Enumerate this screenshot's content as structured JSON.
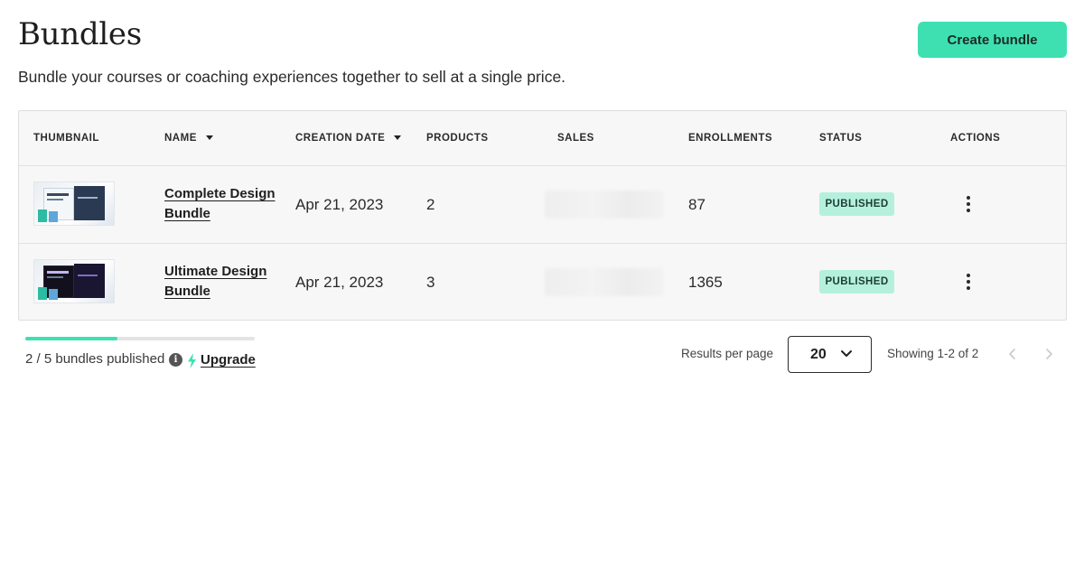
{
  "header": {
    "title": "Bundles",
    "subtitle": "Bundle your courses or coaching experiences together to sell at a single price.",
    "create_label": "Create bundle"
  },
  "table": {
    "columns": [
      "THUMBNAIL",
      "NAME",
      "CREATION DATE",
      "PRODUCTS",
      "SALES",
      "ENROLLMENTS",
      "STATUS",
      "ACTIONS"
    ],
    "rows": [
      {
        "name": "Complete Design Bundle",
        "date": "Apr 21, 2023",
        "products": "2",
        "enrollments": "87",
        "status": "PUBLISHED"
      },
      {
        "name": "Ultimate Design Bundle",
        "date": "Apr 21, 2023",
        "products": "3",
        "enrollments": "1365",
        "status": "PUBLISHED"
      }
    ]
  },
  "footer": {
    "published_text": "2 / 5 bundles published",
    "published_fraction": 0.4,
    "upgrade_label": "Upgrade",
    "results_per_page_label": "Results per page",
    "results_per_page_value": "20",
    "showing_text": "Showing 1-2 of 2"
  },
  "colors": {
    "accent": "#3ee0b2",
    "badge_bg": "#b5f0dd",
    "table_bg": "#f7f7f7"
  },
  "icons": {
    "sort": "caret-down-icon",
    "actions": "kebab-menu-icon",
    "info": "info-icon",
    "upgrade": "lightning-bolt-icon",
    "select": "chevron-down-icon",
    "prev": "chevron-left-icon",
    "next": "chevron-right-icon"
  }
}
